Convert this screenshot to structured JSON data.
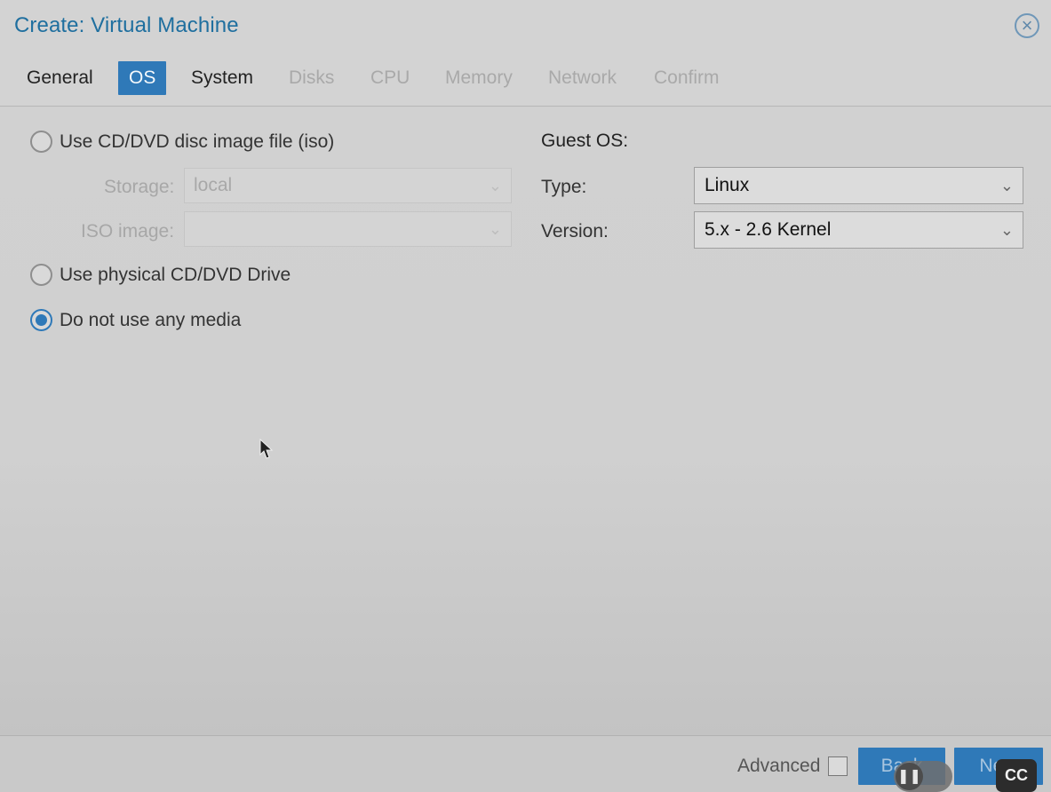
{
  "window": {
    "title": "Create: Virtual Machine"
  },
  "tabs": [
    {
      "label": "General",
      "state": "enabled"
    },
    {
      "label": "OS",
      "state": "active"
    },
    {
      "label": "System",
      "state": "enabled"
    },
    {
      "label": "Disks",
      "state": "disabled"
    },
    {
      "label": "CPU",
      "state": "disabled"
    },
    {
      "label": "Memory",
      "state": "disabled"
    },
    {
      "label": "Network",
      "state": "disabled"
    },
    {
      "label": "Confirm",
      "state": "disabled"
    }
  ],
  "media": {
    "iso_option": "Use CD/DVD disc image file (iso)",
    "storage_label": "Storage:",
    "storage_value": "local",
    "iso_image_label": "ISO image:",
    "iso_image_value": "",
    "physical_option": "Use physical CD/DVD Drive",
    "none_option": "Do not use any media",
    "selected": "none"
  },
  "guest_os": {
    "title": "Guest OS:",
    "type_label": "Type:",
    "type_value": "Linux",
    "version_label": "Version:",
    "version_value": "5.x - 2.6 Kernel"
  },
  "footer": {
    "advanced_label": "Advanced",
    "back_label": "Back",
    "next_label": "Next"
  },
  "overlay": {
    "cc_label": "CC"
  },
  "colors": {
    "accent": "#2f79b8",
    "title": "#1f6f9f"
  }
}
